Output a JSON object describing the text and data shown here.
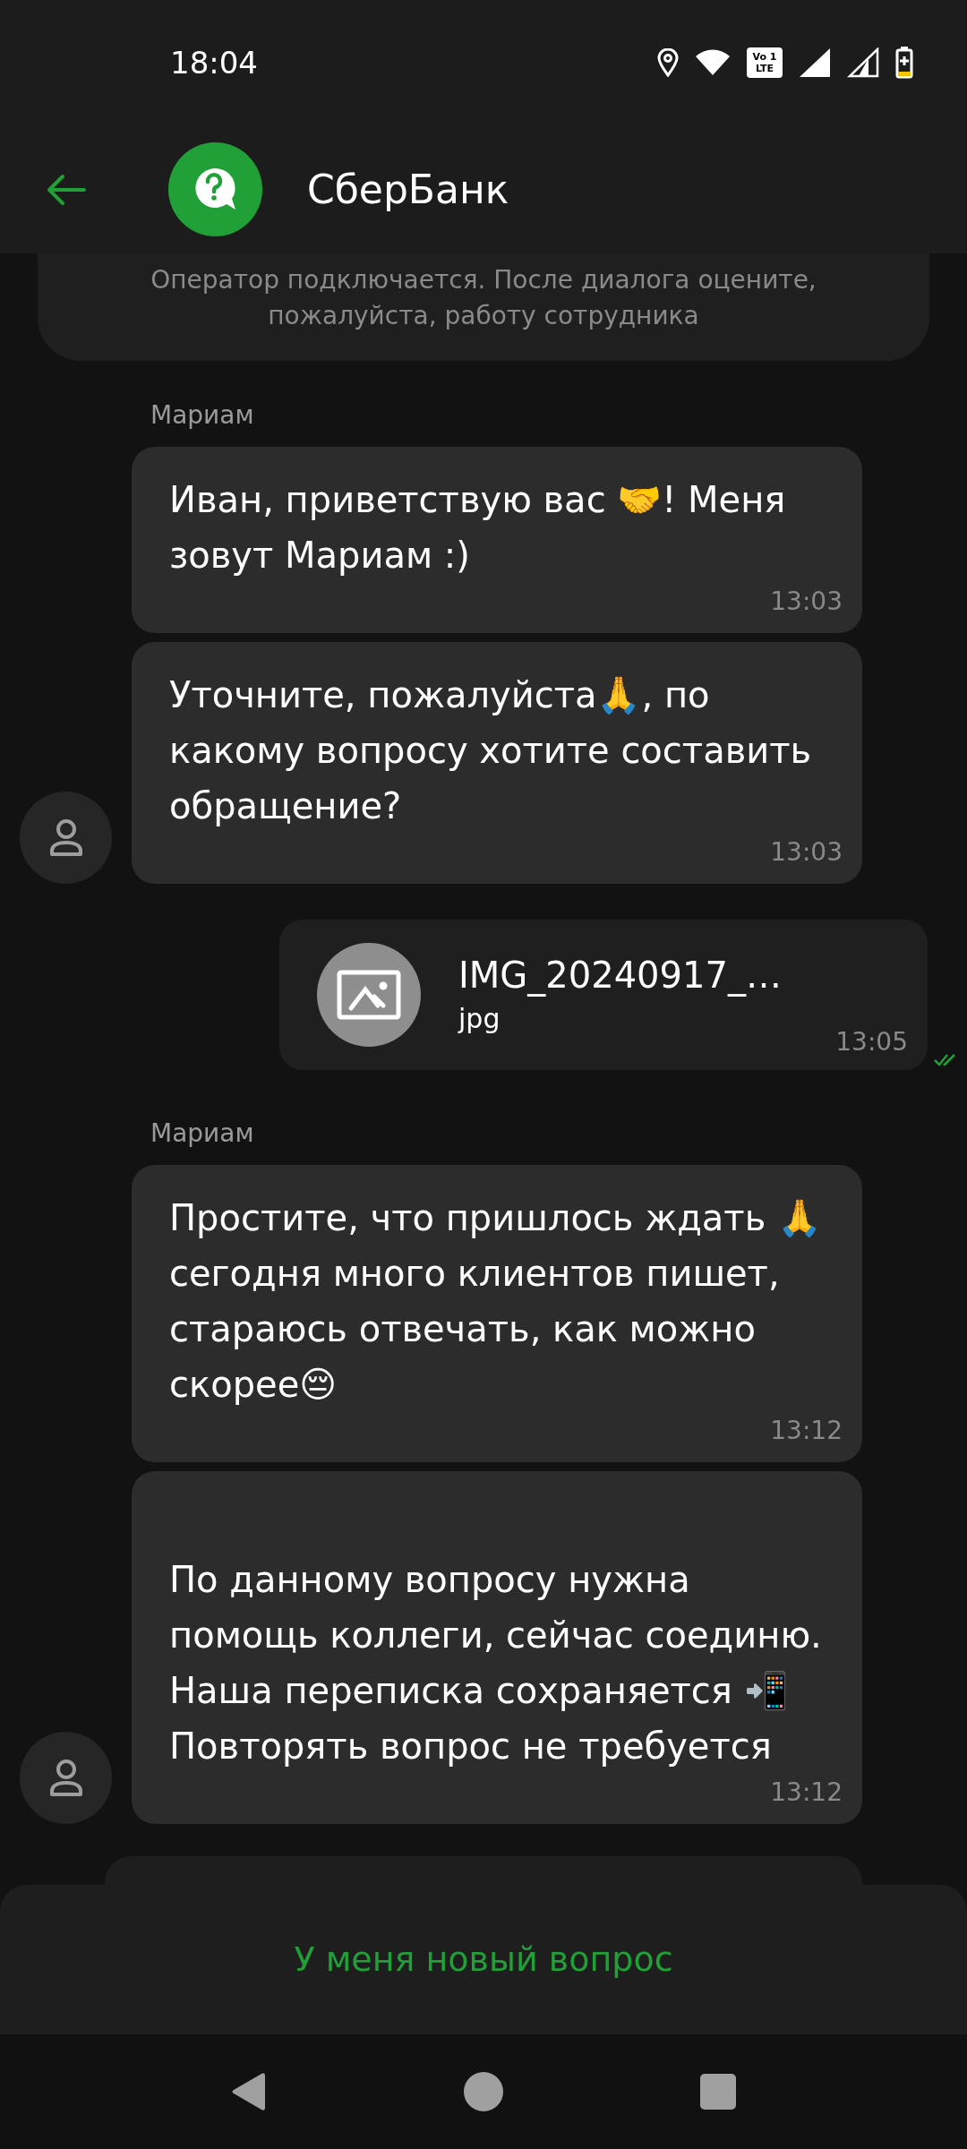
{
  "status_bar": {
    "time": "18:04",
    "volte_top": "Vo 1",
    "volte_bottom": "LTE"
  },
  "header": {
    "title": "СберБанк"
  },
  "system_message": "Оператор подключается. После диалога оцените, пожалуйста, работу сотрудника",
  "chat": [
    {
      "kind": "incoming",
      "sender": "Мариам",
      "messages": [
        {
          "text": "Иван, приветствую вас 🤝! Меня зовут Мариам :)",
          "time": "13:03"
        },
        {
          "text": "Уточните, пожалуйста🙏, по какому вопросу хотите составить обращение?",
          "time": "13:03"
        }
      ]
    },
    {
      "kind": "file",
      "name": "IMG_20240917_…",
      "ext": "jpg",
      "time": "13:05",
      "read": true
    },
    {
      "kind": "incoming",
      "sender": "Мариам",
      "messages": [
        {
          "text": "Простите, что пришлось ждать 🙏 сегодня много клиентов пишет, стараюсь отвечать, как можно скорее😔",
          "time": "13:12"
        },
        {
          "text": "\nПо данному вопросу нужна помощь коллеги, сейчас соединю.\nНаша переписка сохраняется 📲\nПовторять вопрос не требуется",
          "time": "13:12"
        }
      ]
    }
  ],
  "action_button": "У меня новый вопрос"
}
